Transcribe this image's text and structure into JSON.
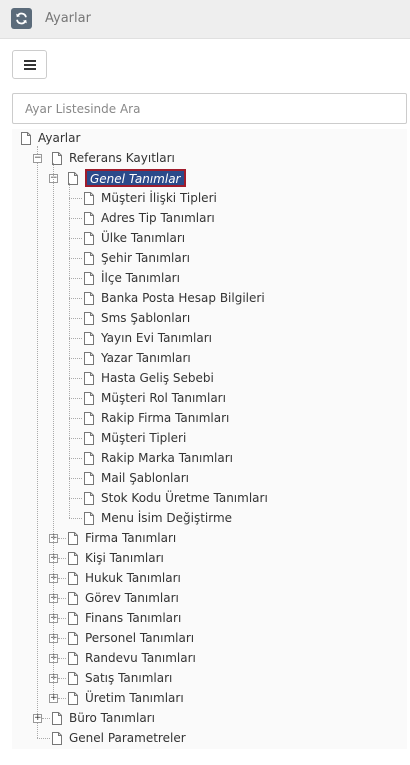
{
  "header": {
    "title": "Ayarlar",
    "refresh_icon": "refresh-icon"
  },
  "toolbar": {
    "menu_icon": "hamburger-icon"
  },
  "search": {
    "placeholder": "Ayar Listesinde Ara",
    "value": ""
  },
  "tree": {
    "root": "Ayarlar",
    "referans": "Referans Kayıtları",
    "genel_tanimlar": "Genel Tanımlar",
    "genel_children": [
      "Müşteri İlişki Tipleri",
      "Adres Tip Tanımları",
      "Ülke Tanımları",
      "Şehir Tanımları",
      "İlçe Tanımları",
      "Banka Posta Hesap Bilgileri",
      "Sms Şablonları",
      "Yayın Evi Tanımları",
      "Yazar Tanımları",
      "Hasta Geliş Sebebi",
      "Müşteri Rol Tanımları",
      "Rakip Firma Tanımları",
      "Müşteri Tipleri",
      "Rakip Marka Tanımları",
      "Mail Şablonları",
      "Stok Kodu Üretme Tanımları",
      "Menu İsim Değiştirme"
    ],
    "referans_groups": [
      "Firma Tanımları",
      "Kişi Tanımları",
      "Hukuk Tanımları",
      "Görev Tanımları",
      "Finans Tanımları",
      "Personel Tanımları",
      "Randevu Tanımları",
      "Satış Tanımları",
      "Üretim Tanımları"
    ],
    "buro": "Büro Tanımları",
    "genel_parametreler": "Genel Parametreler"
  }
}
